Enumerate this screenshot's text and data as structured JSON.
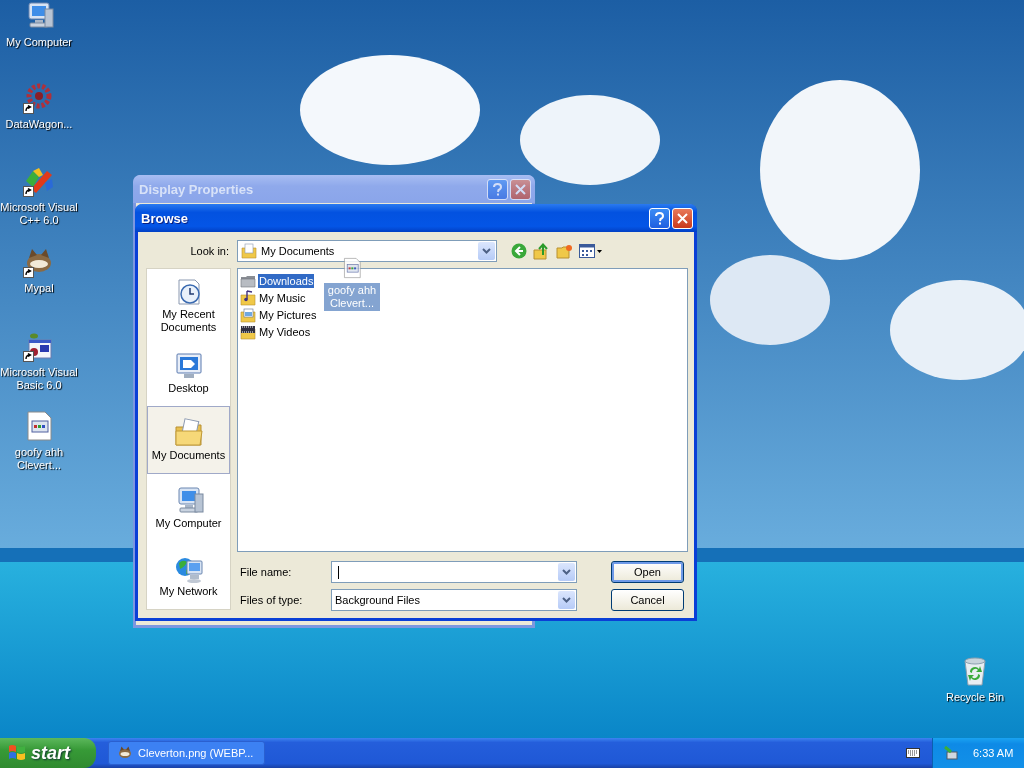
{
  "desktop_icons": [
    {
      "label": "My Computer",
      "kind": "computer",
      "shortcut": false
    },
    {
      "label": "DataWagon...",
      "kind": "flower",
      "shortcut": true
    },
    {
      "label": "Microsoft Visual C++ 6.0",
      "kind": "vcpp",
      "shortcut": true
    },
    {
      "label": "Mypal",
      "kind": "mascot",
      "shortcut": true
    },
    {
      "label": "Microsoft Visual Basic 6.0",
      "kind": "vb",
      "shortcut": true
    },
    {
      "label": "goofy ahh Clevert...",
      "kind": "file",
      "shortcut": false
    },
    {
      "label": "Recycle Bin",
      "kind": "recycle",
      "shortcut": false
    }
  ],
  "background_window": {
    "title": "Display Properties",
    "active": false
  },
  "dialog": {
    "title": "Browse",
    "active": true,
    "look_in": {
      "label": "Look in:",
      "value": "My Documents"
    },
    "places": [
      {
        "label": "My Recent Documents",
        "kind": "recent",
        "selected": false
      },
      {
        "label": "Desktop",
        "kind": "desktop",
        "selected": false
      },
      {
        "label": "My Documents",
        "kind": "documents",
        "selected": true
      },
      {
        "label": "My Computer",
        "kind": "computer",
        "selected": false
      },
      {
        "label": "My Network",
        "kind": "network",
        "selected": false
      }
    ],
    "files": [
      {
        "name": "Downloads",
        "kind": "folder",
        "selected": true
      },
      {
        "name": "My Music",
        "kind": "music",
        "selected": false
      },
      {
        "name": "My Pictures",
        "kind": "pictures",
        "selected": false
      },
      {
        "name": "My Videos",
        "kind": "videos",
        "selected": false
      }
    ],
    "drag_item": {
      "label": "goofy ahh Clevert..."
    },
    "file_name": {
      "label": "File name:"
    },
    "file_type": {
      "label": "Files of type:",
      "value": "Background Files"
    },
    "buttons": [
      {
        "label": "Open",
        "default": true
      },
      {
        "label": "Cancel",
        "default": false
      }
    ]
  },
  "taskbar": {
    "start": "start",
    "tasks": [
      {
        "label": "Cleverton.png (WEBP...",
        "selected": false
      }
    ],
    "clock": "6:33 AM"
  }
}
